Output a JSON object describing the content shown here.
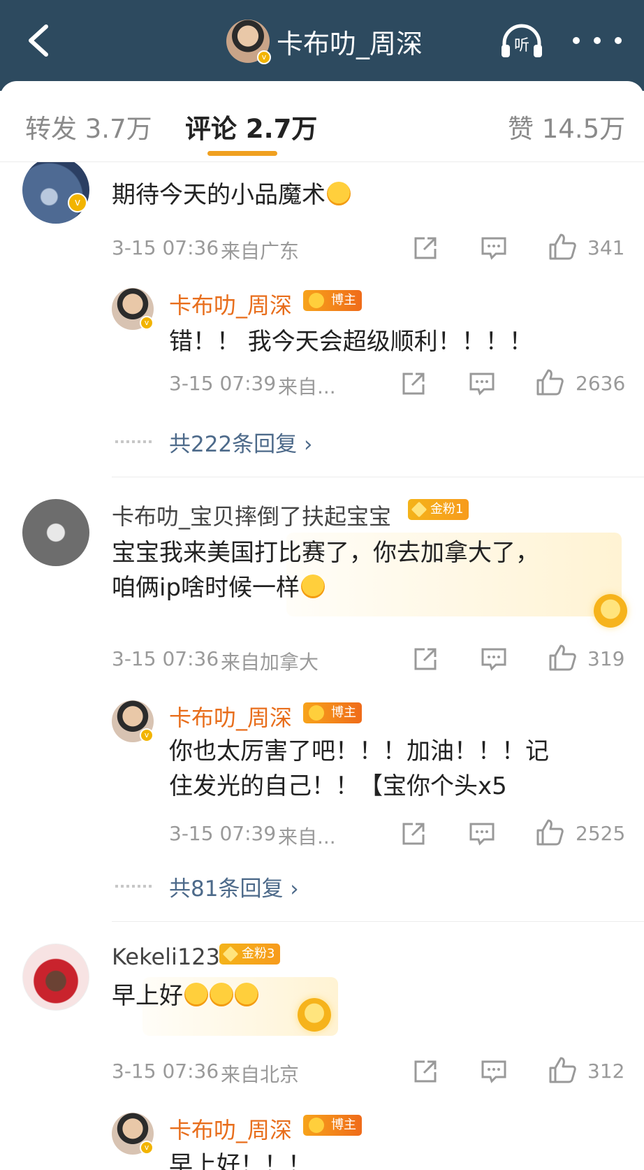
{
  "header": {
    "title": "卡布叻_周深",
    "listen_label": "听"
  },
  "tabs": [
    {
      "label": "转发 3.7万"
    },
    {
      "label": "评论 2.7万"
    },
    {
      "label": "赞 14.5万"
    }
  ],
  "comments": [
    {
      "text": "期待今天的小品魔术",
      "time": "3-15 07:36",
      "location": "来自广东",
      "likes": "341",
      "reply": {
        "name": "卡布叻_周深",
        "badge": "博主",
        "text_lines": [
          "错！！ 我今天会超级顺利！！！！"
        ],
        "time": "3-15 07:39",
        "location": "来自...",
        "likes": "2636"
      },
      "more_replies": "共222条回复"
    },
    {
      "name": "卡布叻_宝贝摔倒了扶起宝宝",
      "badge": "金粉1",
      "text_lines": [
        "宝宝我来美国打比赛了，你去加拿大了，",
        "咱俩ip啥时候一样"
      ],
      "time": "3-15 07:36",
      "location": "来自加拿大",
      "likes": "319",
      "reply": {
        "name": "卡布叻_周深",
        "badge": "博主",
        "text_lines": [
          "你也太厉害了吧！！！加油！！！记",
          "住发光的自己！！【宝你个头x5"
        ],
        "time": "3-15 07:39",
        "location": "来自...",
        "likes": "2525"
      },
      "more_replies": "共81条回复"
    },
    {
      "name": "Kekeli123",
      "badge": "金粉3",
      "text": "早上好",
      "time": "3-15 07:36",
      "location": "来自北京",
      "likes": "312",
      "reply": {
        "name": "卡布叻_周深",
        "badge": "博主",
        "text_lines": [
          "早上好！！！"
        ]
      }
    }
  ],
  "colors": {
    "header_bg": "#2d4a5f",
    "author_name": "#e86e1c",
    "link_blue": "#4d6a8a",
    "tab_underline": "#f0a020"
  }
}
